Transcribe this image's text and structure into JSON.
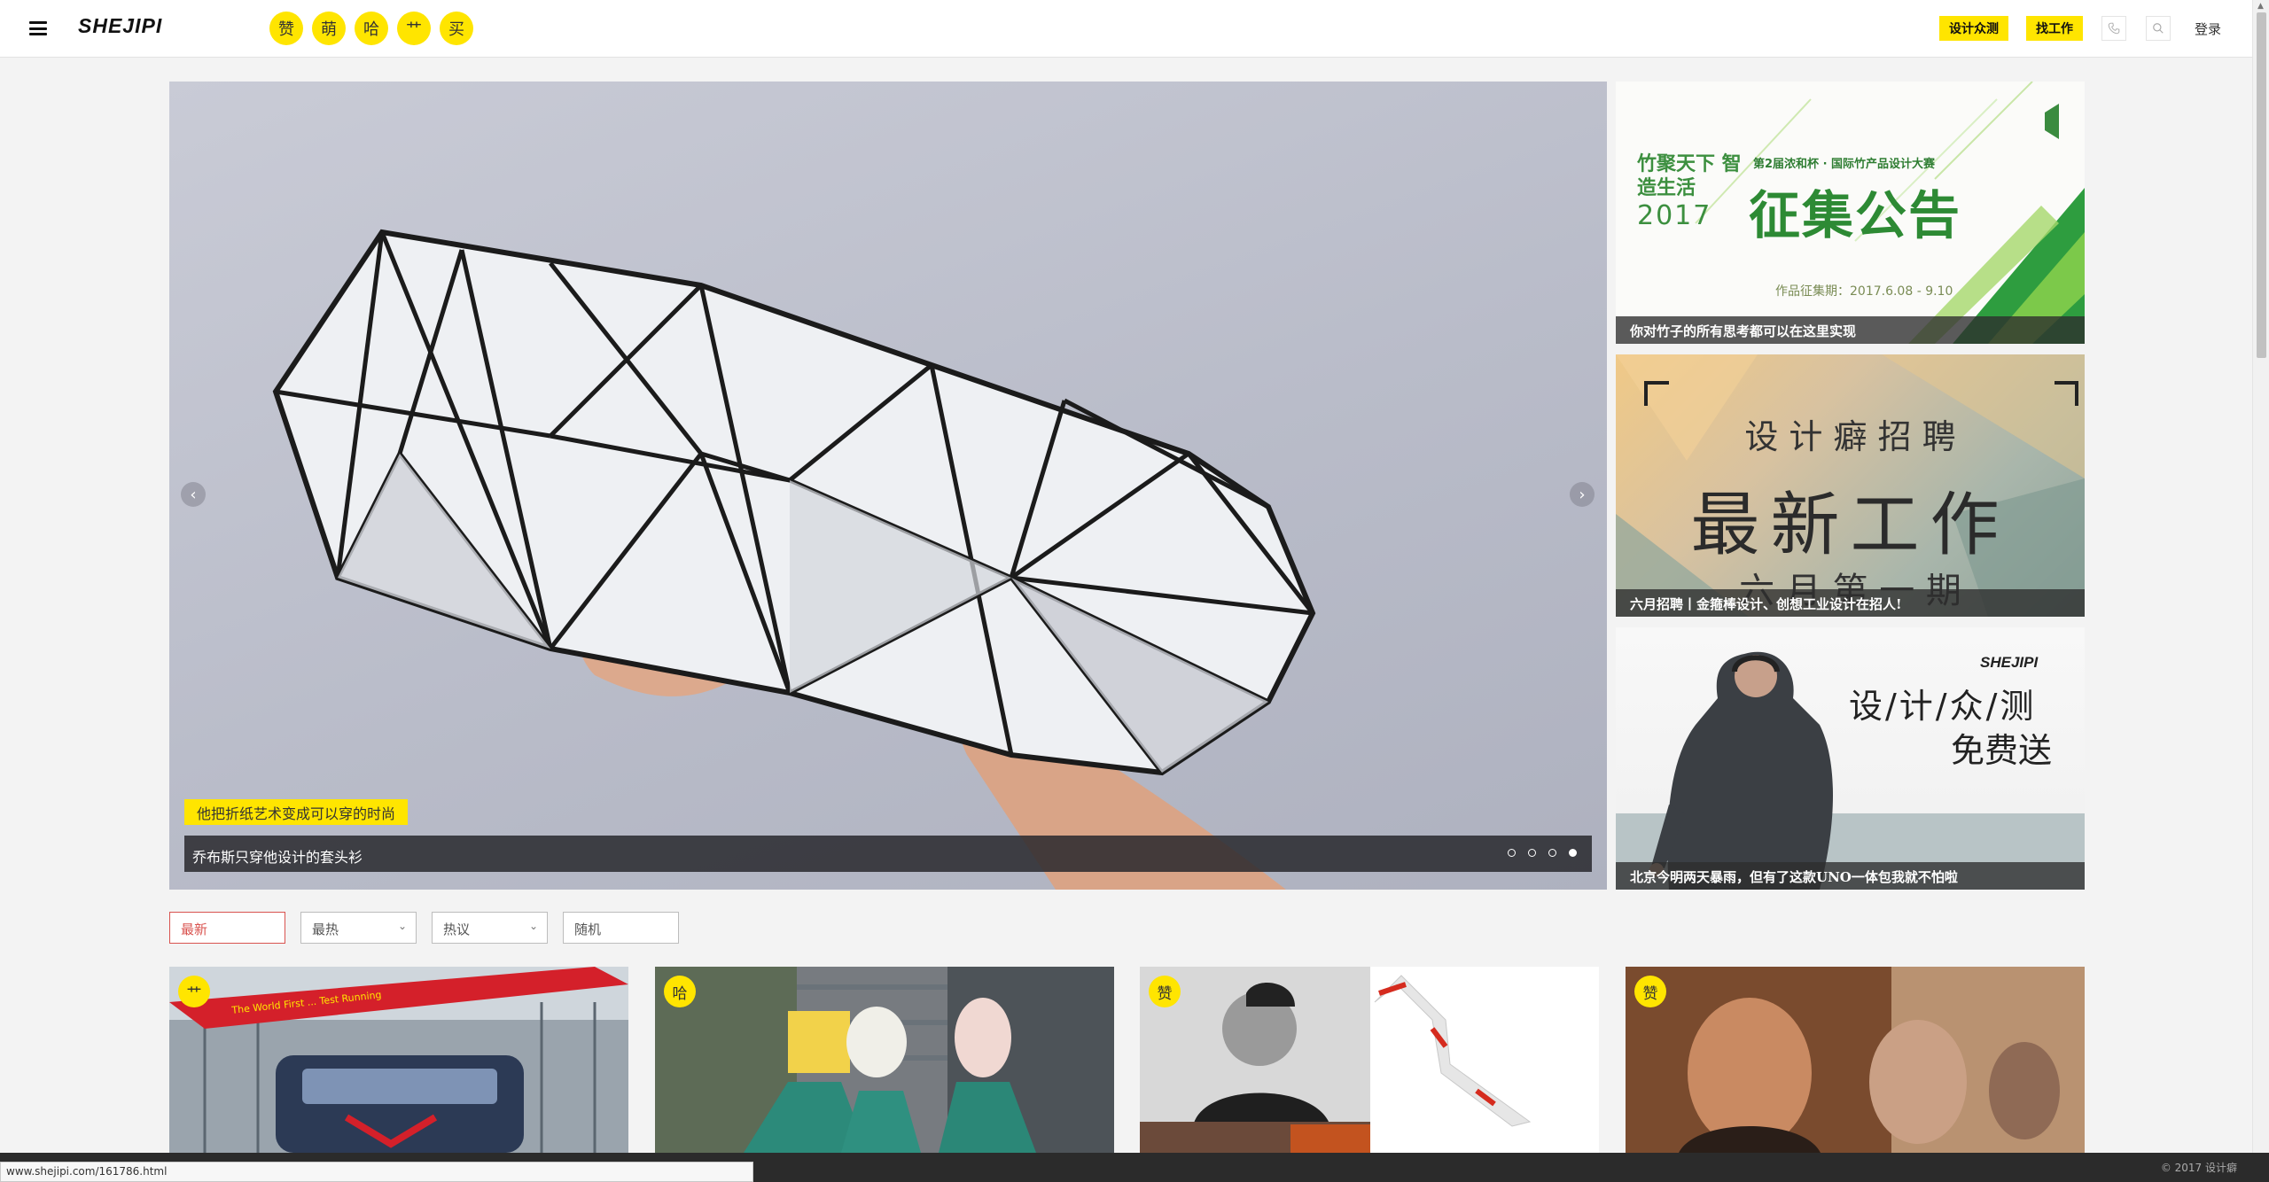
{
  "header": {
    "logo": "SHEJIPI",
    "categories": [
      "赞",
      "萌",
      "哈",
      "艹",
      "买"
    ],
    "btn_design_test": "设计众测",
    "btn_find_job": "找工作",
    "login": "登录"
  },
  "hero": {
    "tag": "他把折纸艺术变成可以穿的时尚",
    "caption": "乔布斯只穿他设计的套头衫",
    "slide_count": 4,
    "active_slide": 4
  },
  "side_banners": [
    {
      "headline_left": "竹聚天下 智造生活",
      "year": "2017",
      "subtitle": "第2届浓和杯 · 国际竹产品设计大赛",
      "title": "征集公告",
      "dates": "作品征集期：2017.6.08 - 9.10",
      "caption": "你对竹子的所有思考都可以在这里实现"
    },
    {
      "line1": "设 计 癖 招 聘",
      "line2": "最新工作",
      "line3": "六 月 第 一 期",
      "caption": "六月招聘丨金箍棒设计、创想工业设计在招人!"
    },
    {
      "brand": "SHEJIPI",
      "line1": "设/计/众/测",
      "line2": "免费送",
      "caption": "北京今明两天暴雨，但有了这款UNO一体包我就不怕啦"
    }
  ],
  "filters": [
    {
      "label": "最新",
      "active": true,
      "dropdown": false
    },
    {
      "label": "最热",
      "active": false,
      "dropdown": true
    },
    {
      "label": "热议",
      "active": false,
      "dropdown": true
    },
    {
      "label": "随机",
      "active": false,
      "dropdown": false
    }
  ],
  "cards": [
    {
      "badge": "艹",
      "banner_text": "The World First ... Test Running"
    },
    {
      "badge": "哈"
    },
    {
      "badge": "赞"
    },
    {
      "badge": "赞"
    }
  ],
  "footer": {
    "copyright": "© 2017 设计癖"
  },
  "status_url": "www.shejipi.com/161786.html",
  "colors": {
    "accent": "#ffe500",
    "active_filter": "#d9534f",
    "footer": "#2b2b2b"
  }
}
